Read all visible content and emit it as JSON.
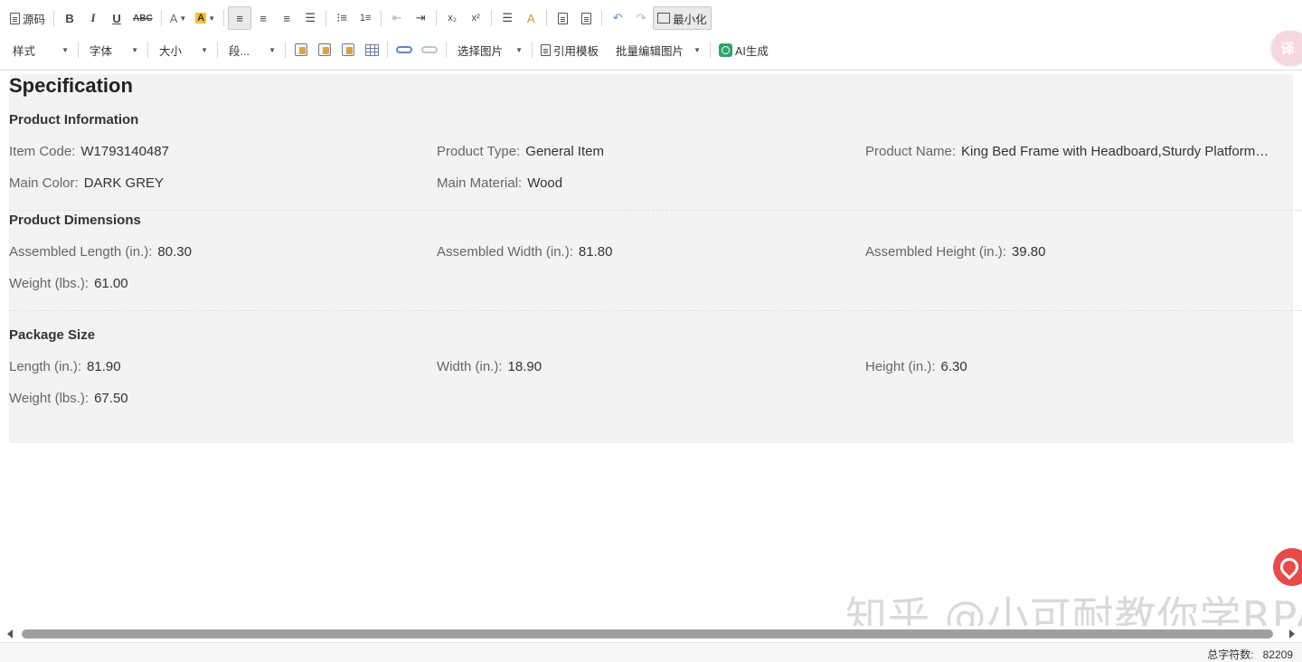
{
  "toolbar": {
    "source_label": "源码",
    "minimize_label": "最小化",
    "style_combo": "样式",
    "font_combo": "字体",
    "size_combo": "大小",
    "paragraph_combo": "段...",
    "select_image_label": "选择图片",
    "template_label": "引用模板",
    "batch_edit_label": "批量编辑图片",
    "ai_label": "AI生成",
    "bold_glyph": "B",
    "italic_glyph": "I",
    "underline_glyph": "U",
    "strike_glyph": "ABC"
  },
  "document": {
    "title": "Specification",
    "sections": {
      "product_info": {
        "title": "Product Information",
        "item_code_key": "Item Code:",
        "item_code_val": "W1793140487",
        "product_type_key": "Product Type:",
        "product_type_val": "General Item",
        "product_name_key": "Product Name:",
        "product_name_val": "King Bed Frame with Headboard,Sturdy Platform B...",
        "main_color_key": "Main Color:",
        "main_color_val": "DARK GREY",
        "main_material_key": "Main Material:",
        "main_material_val": "Wood"
      },
      "dimensions": {
        "title": "Product Dimensions",
        "length_key": "Assembled Length (in.):",
        "length_val": "80.30",
        "width_key": "Assembled Width (in.):",
        "width_val": "81.80",
        "height_key": "Assembled Height (in.):",
        "height_val": "39.80",
        "weight_key": "Weight (lbs.):",
        "weight_val": "61.00"
      },
      "package": {
        "title": "Package Size",
        "length_key": "Length (in.):",
        "length_val": "81.90",
        "width_key": "Width (in.):",
        "width_val": "18.90",
        "height_key": "Height (in.):",
        "height_val": "6.30",
        "weight_key": "Weight (lbs.):",
        "weight_val": "67.50"
      }
    }
  },
  "watermark": "知乎 @小可耐教你学RPA",
  "statusbar": {
    "char_count_label": "总字符数:",
    "char_count_value": "82209"
  },
  "colors": {
    "content_bg": "#f3f3f3",
    "accent_red": "#e84a4a",
    "ai_green": "#2fa36b"
  }
}
